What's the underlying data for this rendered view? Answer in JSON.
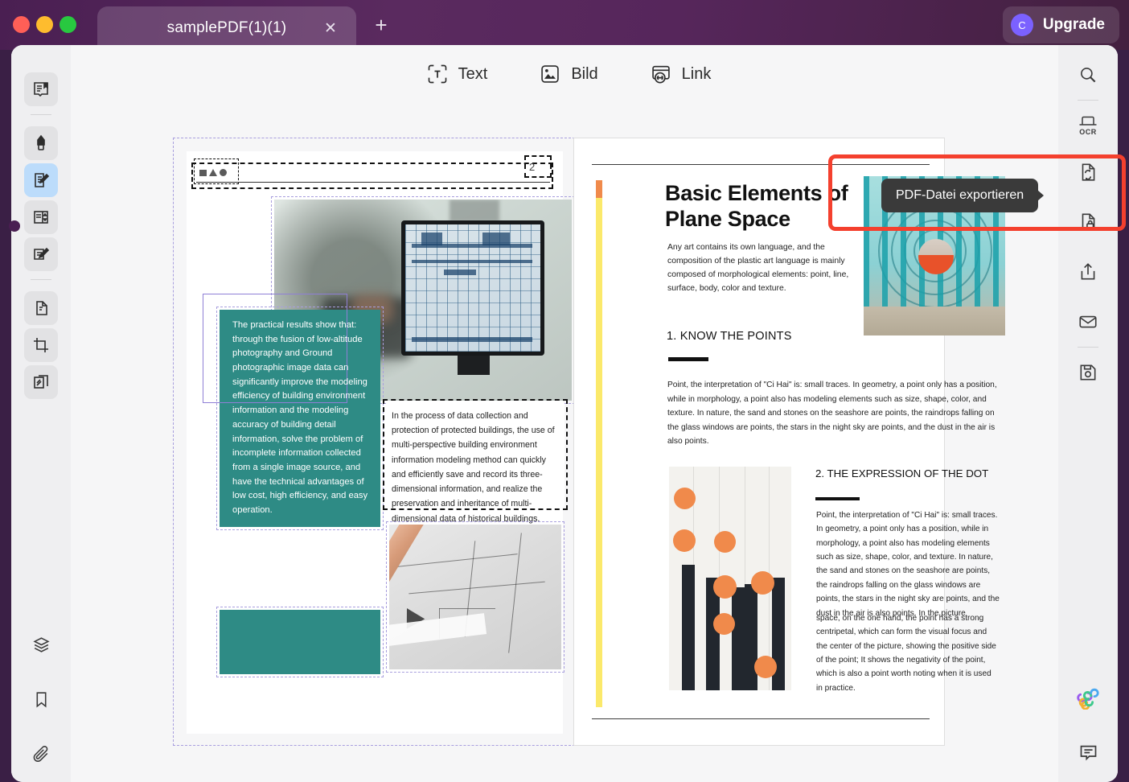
{
  "window": {
    "tab_title": "samplePDF(1)(1)",
    "close_icon": "close-icon",
    "new_tab_icon": "plus-icon",
    "upgrade_badge": "C",
    "upgrade_label": "Upgrade"
  },
  "toolbar": {
    "items": [
      {
        "label": "Text",
        "icon": "text-tool-icon"
      },
      {
        "label": "Bild",
        "icon": "image-tool-icon"
      },
      {
        "label": "Link",
        "icon": "link-tool-icon"
      }
    ]
  },
  "left_rail": {
    "items": [
      {
        "name": "reader-view-icon"
      },
      {
        "name": "highlighter-icon"
      },
      {
        "name": "edit-text-icon"
      },
      {
        "name": "page-panel-icon"
      },
      {
        "name": "annotate-icon"
      },
      {
        "name": "organize-pages-icon"
      },
      {
        "name": "crop-icon"
      },
      {
        "name": "compare-pages-icon"
      },
      {
        "name": "layers-icon"
      },
      {
        "name": "bookmark-icon"
      },
      {
        "name": "attachment-icon"
      }
    ]
  },
  "right_rail": {
    "items": [
      {
        "name": "search-icon"
      },
      {
        "name": "ocr-icon",
        "label": "OCR"
      },
      {
        "name": "export-pdf-icon"
      },
      {
        "name": "protect-document-icon"
      },
      {
        "name": "share-icon"
      },
      {
        "name": "email-icon"
      },
      {
        "name": "save-icon"
      },
      {
        "name": "ai-assistant-icon"
      },
      {
        "name": "comment-icon"
      }
    ]
  },
  "tooltip": {
    "text": "PDF-Datei exportieren"
  },
  "document": {
    "left_page": {
      "header_page_number": "2",
      "teal_text_block": "The practical results show that: through the fusion of low-altitude photography and Ground photographic image data can significantly improve the modeling efficiency of building environment information and the modeling accuracy of building detail information, solve the problem of incomplete information collected from a single image source, and have the technical advantages of low cost, high efficiency, and easy operation.",
      "white_text_block": "In the process of data collection and protection of protected buildings, the use of multi-perspective building environment information modeling method can quickly and efficiently save and record its three-dimensional information, and realize the preservation and inheritance of multi-dimensional data of historical buildings.",
      "image_monitor_alt": "monitor-showing-bim-model-image",
      "image_draft_alt": "pencil-on-blueprint-image"
    },
    "right_page": {
      "title": "Basic Elements of Plane Space",
      "lead": "Any art contains its own language, and the composition of the plastic art language is mainly composed of morphological elements: point, line, surface, body, color and texture.",
      "heading_1": "1. KNOW THE POINTS",
      "body_1": "Point, the interpretation of \"Ci Hai\" is: small traces. In geometry, a point only has a position, while in morphology, a point also has modeling elements such as size, shape, color, and texture. In nature, the sand and stones on the seashore are points, the raindrops falling on the glass windows are points, the stars in the night sky are points, and the dust in the air is also points.",
      "heading_2": "2. THE  EXPRESSION   OF  THE DOT",
      "body_2": "Point, the interpretation of \"Ci Hai\" is: small traces. In geometry, a point only has a position, while in morphology, a point also has modeling elements such as size, shape, color, and texture. In nature, the sand and stones on the seashore are points, the raindrops falling on the glass windows are points, the stars in the night sky are points, and the dust in the air is also points. In the picture",
      "body_3": "space, on the one hand, the point has a strong centripetal, which can form the visual focus and the center of the picture, showing the positive side of the point; It shows the negativity of the point, which is also a point worth noting when it is used in practice.",
      "image_arch_alt": "teal-arch-tunnel-photo",
      "image_dots_alt": "orange-dots-on-stripes-artwork"
    }
  },
  "colors": {
    "titlebar": "#4a1f52",
    "accent_teal": "#2e8b85",
    "highlight_red": "#f4402e",
    "tooltip_bg": "#3a3a3a",
    "active_tool": "#bcdcfb",
    "upgrade_badge": "#7b61ff",
    "yellow_strip": "#fbe96b",
    "orange_dot": "#f08a4b"
  }
}
